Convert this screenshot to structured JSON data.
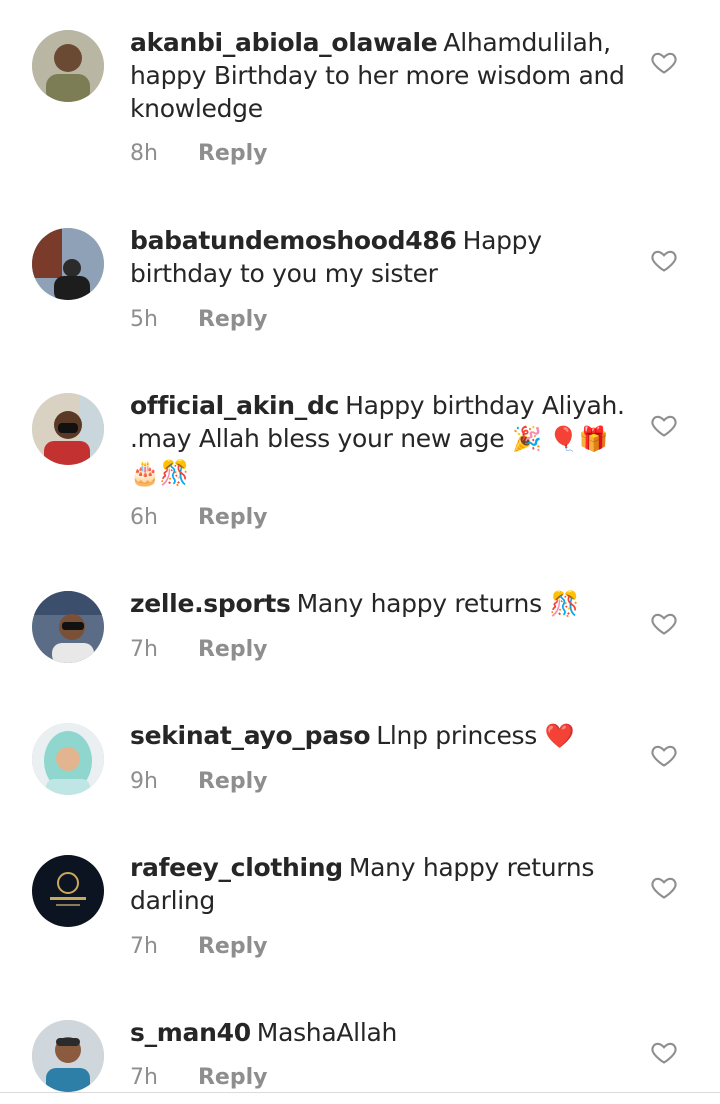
{
  "comments": [
    {
      "username": "akanbi_abiola_olawale",
      "text": "Alhamdulilah, happy Birthday to her more wisdom and knowledge",
      "emoji": "",
      "time": "8h",
      "reply": "Reply"
    },
    {
      "username": "babatundemoshood486",
      "text": "Happy birthday to you my sister",
      "emoji": "",
      "time": "5h",
      "reply": "Reply"
    },
    {
      "username": "official_akin_dc",
      "text": "Happy birthday Aliyah. .may Allah bless your new age",
      "emoji": "🎉 🎈🎁🎂🎊",
      "time": "6h",
      "reply": "Reply"
    },
    {
      "username": "zelle.sports",
      "text": "Many happy returns",
      "emoji": "🎊",
      "time": "7h",
      "reply": "Reply"
    },
    {
      "username": "sekinat_ayo_paso",
      "text": "Llnp princess",
      "emoji": "❤️",
      "time": "9h",
      "reply": "Reply"
    },
    {
      "username": "rafeey_clothing",
      "text": "Many happy returns darling",
      "emoji": "",
      "time": "7h",
      "reply": "Reply"
    },
    {
      "username": "s_man40",
      "text": "MashaAllah",
      "emoji": "",
      "time": "7h",
      "reply": "Reply"
    }
  ],
  "icons": {
    "like": "heart-outline-icon"
  },
  "colors": {
    "text": "#262626",
    "meta": "#8e8e8e",
    "heart": "#8e8e8e"
  }
}
